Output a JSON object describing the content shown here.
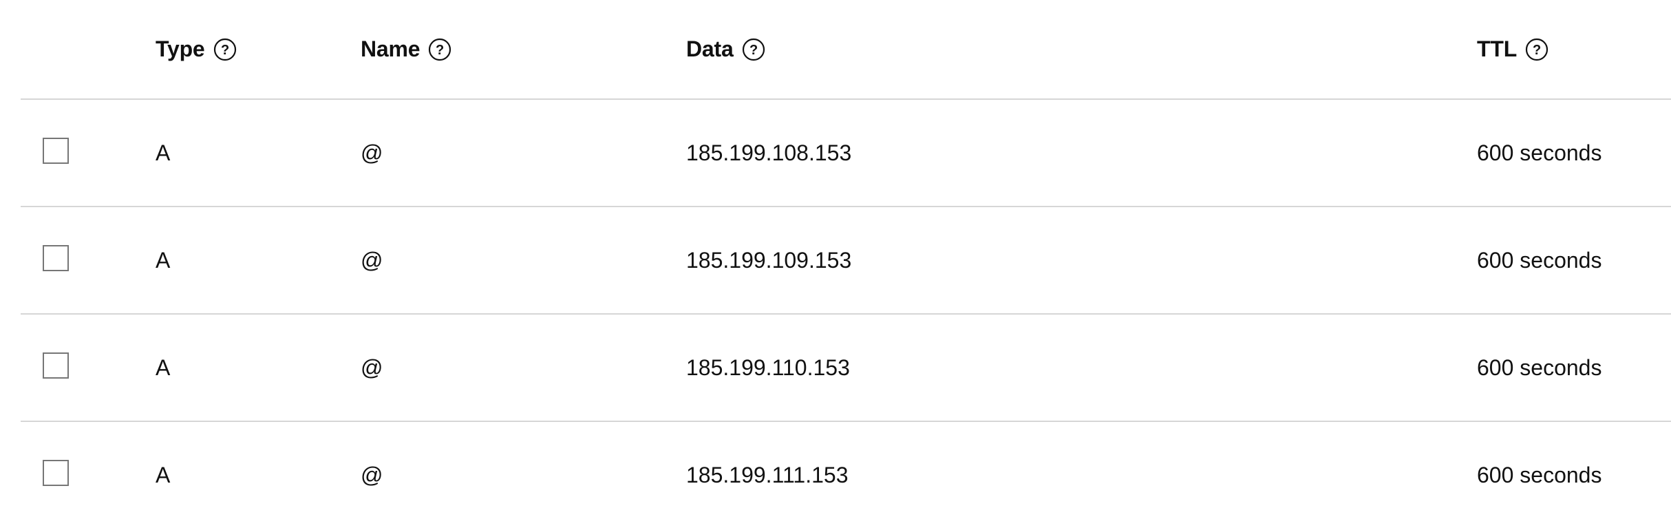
{
  "table": {
    "headers": {
      "type": "Type",
      "name": "Name",
      "data": "Data",
      "ttl": "TTL"
    },
    "help_icon_glyph": "?",
    "rows": [
      {
        "type": "A",
        "name": "@",
        "data": "185.199.108.153",
        "ttl": "600 seconds",
        "checked": false
      },
      {
        "type": "A",
        "name": "@",
        "data": "185.199.109.153",
        "ttl": "600 seconds",
        "checked": false
      },
      {
        "type": "A",
        "name": "@",
        "data": "185.199.110.153",
        "ttl": "600 seconds",
        "checked": false
      },
      {
        "type": "A",
        "name": "@",
        "data": "185.199.111.153",
        "ttl": "600 seconds",
        "checked": false
      }
    ]
  },
  "colors": {
    "divider": "#d6d6d6",
    "text": "#111111",
    "checkbox_border": "#767676"
  },
  "icons": {
    "help": "question-circle-icon",
    "row_select": "checkbox"
  }
}
